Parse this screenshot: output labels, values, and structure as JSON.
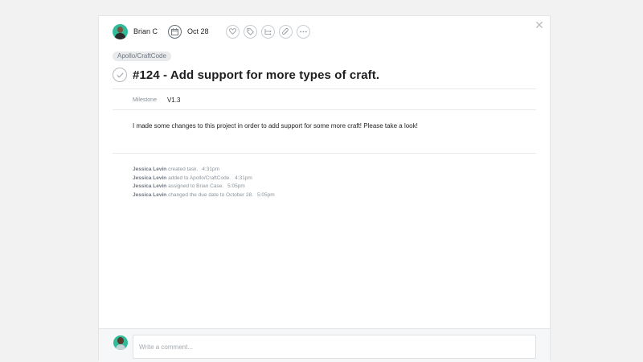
{
  "header": {
    "assignee_name": "Brian C",
    "due_date": "Oct 28",
    "actions": [
      "heart-icon",
      "tag-icon",
      "subtask-icon",
      "attachment-icon",
      "more-icon"
    ]
  },
  "task": {
    "project_tag": "Apollo/CraftCode",
    "title": "#124 - Add support for more types of craft.",
    "milestone_label": "Milestone",
    "milestone_value": "V1.3",
    "description": "I made some changes to this project in order to add support for some more craft! Please take a look!"
  },
  "stories": [
    {
      "author": "Jessica Levin",
      "text": " created task.",
      "time": "4:31pm"
    },
    {
      "author": "Jessica Levin",
      "text": " added to Apollo/CraftCode.",
      "time": "4:31pm"
    },
    {
      "author": "Jessica Levin",
      "text": " assigned to Brian Case.",
      "time": "5:05pm"
    },
    {
      "author": "Jessica Levin",
      "text": " changed the due date to October 28.",
      "time": "5:05pm"
    }
  ],
  "comment": {
    "placeholder": "Write a comment..."
  },
  "colors": {
    "avatar_bg": "#2fbc9b",
    "page_bg": "#f2f2f3"
  }
}
